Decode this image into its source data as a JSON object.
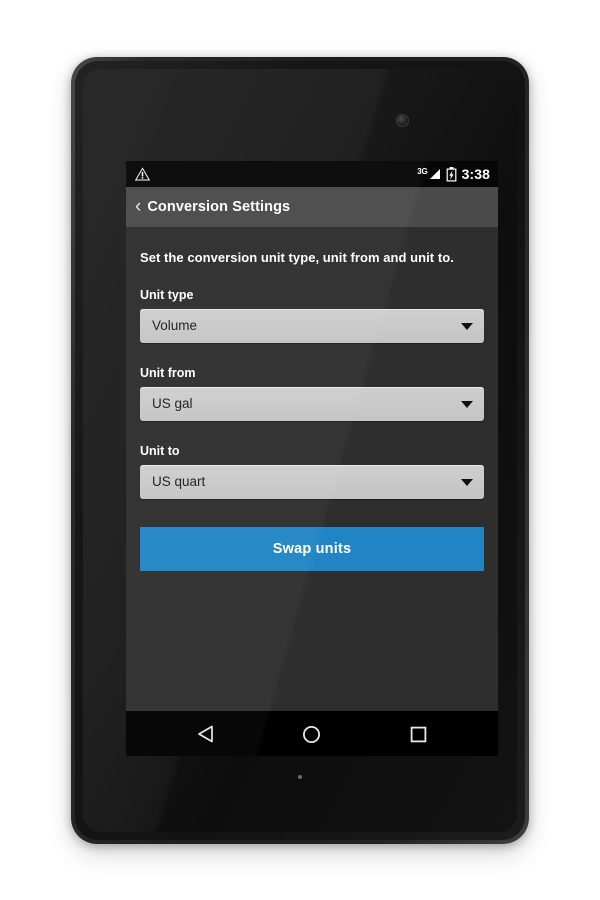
{
  "device": {
    "type": "android-tablet",
    "camera": "front-camera",
    "notification_led": "status-led"
  },
  "statusbar": {
    "warning_icon": "warning-triangle-icon",
    "network_label": "3G",
    "signal_icon": "signal-bars-icon",
    "battery_icon": "battery-charging-icon",
    "time": "3:38"
  },
  "actionbar": {
    "back_icon": "‹",
    "title": "Conversion Settings"
  },
  "main": {
    "intro": "Set the conversion unit type, unit from and unit to.",
    "fields": [
      {
        "label": "Unit type",
        "value": "Volume",
        "arrow_icon": "chevron-down-icon"
      },
      {
        "label": "Unit from",
        "value": "US gal",
        "arrow_icon": "chevron-down-icon"
      },
      {
        "label": "Unit to",
        "value": "US quart",
        "arrow_icon": "chevron-down-icon"
      }
    ],
    "swap_button": {
      "label": "Swap units",
      "color": "#2185c5"
    }
  },
  "navbar": {
    "back": "back-triangle-icon",
    "home": "home-circle-icon",
    "recents": "recents-square-icon"
  },
  "colors": {
    "accent": "#2185c5",
    "content_bg": "#2e2e2e",
    "actionbar_bg": "#4a4a4a",
    "spinner_bg": "#c8c8c8",
    "statusbar_bg": "#060606"
  }
}
